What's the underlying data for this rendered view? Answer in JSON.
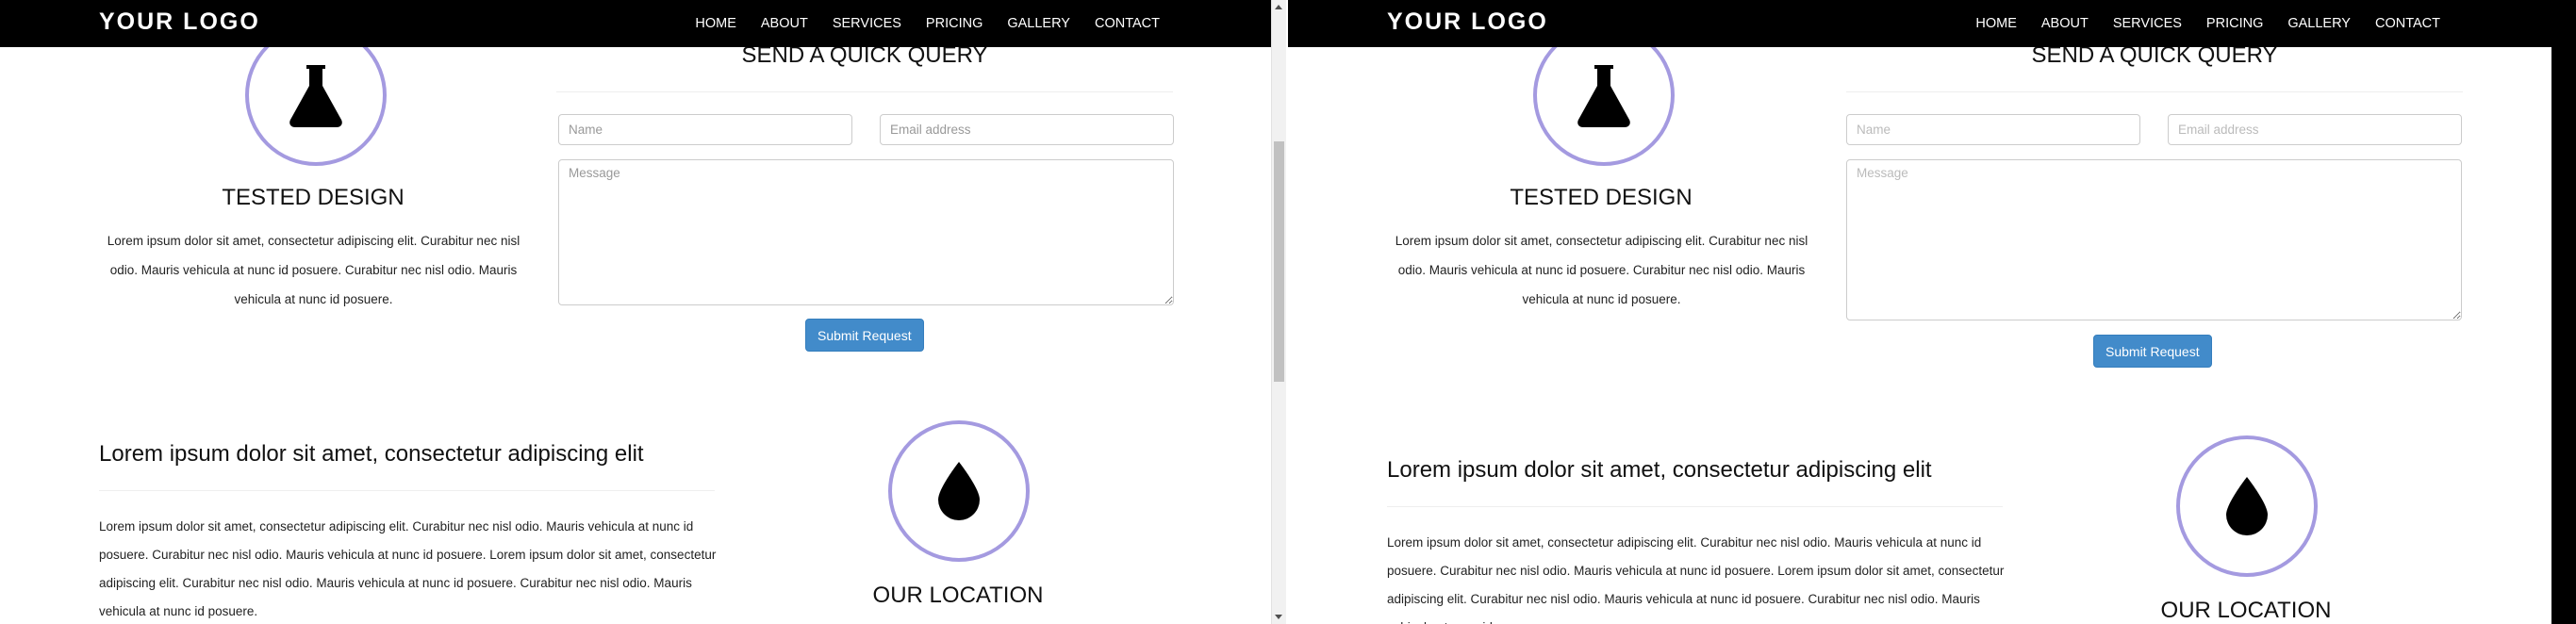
{
  "navbar": {
    "logo": "YOUR LOGO",
    "menu": [
      "HOME",
      "ABOUT",
      "SERVICES",
      "PRICING",
      "GALLERY",
      "CONTACT"
    ]
  },
  "feature": {
    "icon": "flask-icon",
    "title": "TESTED DESIGN",
    "text": "Lorem ipsum dolor sit amet, consectetur adipiscing elit. Curabitur nec nisl odio. Mauris vehicula at nunc id posuere. Curabitur nec nisl odio. Mauris vehicula at nunc id posuere."
  },
  "query_form": {
    "title": "SEND A QUICK QUERY",
    "name_placeholder": "Name",
    "email_placeholder": "Email address",
    "message_placeholder": "Message",
    "submit_label": "Submit Request"
  },
  "about": {
    "heading": "Lorem ipsum dolor sit amet, consectetur adipiscing elit",
    "paragraph": "Lorem ipsum dolor sit amet, consectetur adipiscing elit. Curabitur nec nisl odio. Mauris vehicula at nunc id posuere. Curabitur nec nisl odio. Mauris vehicula at nunc id posuere. Lorem ipsum dolor sit amet, consectetur adipiscing elit. Curabitur nec nisl odio. Mauris vehicula at nunc id posuere. Curabitur nec nisl odio. Mauris vehicula at nunc id posuere."
  },
  "location": {
    "icon": "water-drop-icon",
    "title": "OUR LOCATION"
  },
  "colors": {
    "navbar_bg": "#000000",
    "circle_border": "#a49ae0",
    "button_bg": "#428bca"
  }
}
